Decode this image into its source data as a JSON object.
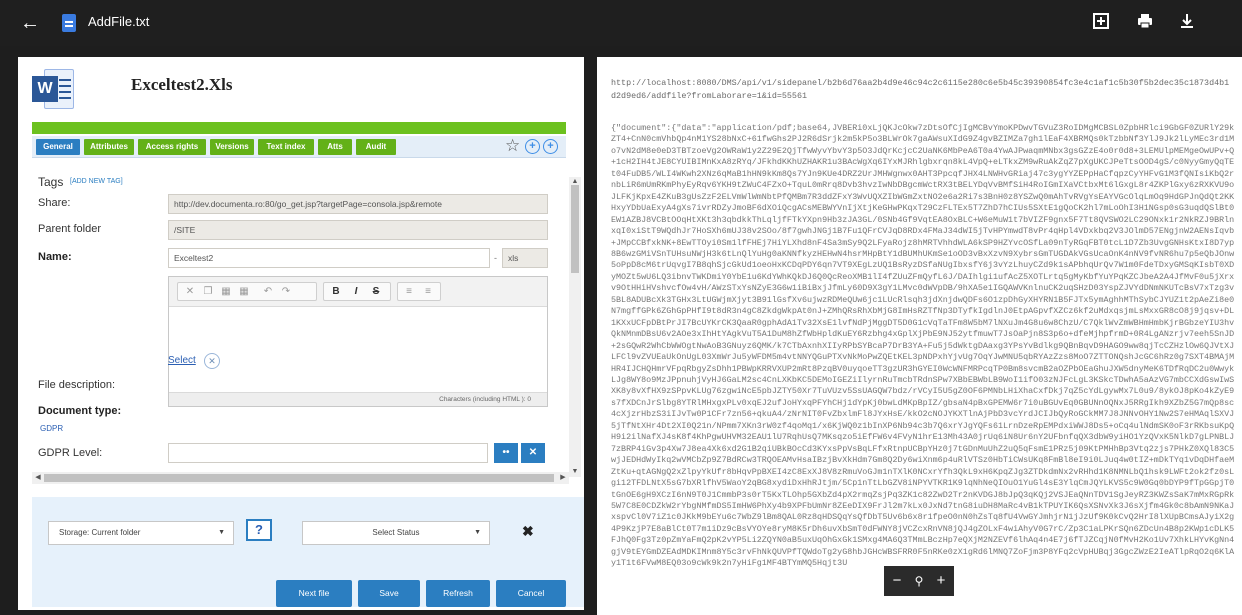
{
  "viewer": {
    "file_name": "AddFile.txt",
    "icons": [
      "back-arrow-icon",
      "text-file-icon",
      "add-box-icon",
      "print-icon",
      "download-icon"
    ]
  },
  "form": {
    "title": "Exceltest2.Xls",
    "tabs": [
      "General",
      "Attributes",
      "Access rights",
      "Versions",
      "Text index",
      "Atts",
      "Audit"
    ],
    "tags_label": "Tags",
    "add_tag": "[ADD NEW TAG]",
    "share_label": "Share:",
    "share_value": "http://dev.documenta.ro:80/go_get.jsp?targetPage=consola.jsp&remote",
    "parent_label": "Parent folder",
    "parent_value": "/SITE",
    "name_label": "Name:",
    "name_value": "Exceltest2",
    "ext_value": "xls",
    "description_label": "File description:",
    "editor_footer": "Characters (including HTML ): 0",
    "doctype_label": "Document type:",
    "doctype_select": "Select",
    "gdpr_link": "GDPR",
    "gdpr_level_label": "GDPR Level:",
    "storage_select": "Storage: Current folder",
    "help_label": "?",
    "status_select": "Select Status",
    "buttons": {
      "next": "Next file",
      "save": "Save",
      "refresh": "Refresh",
      "cancel": "Cancel"
    }
  },
  "preview": {
    "url": "http://localhost:8080/DMS/api/v1/sidepanel/b2b6d76aa2b4d9e46c94c2c6115e280c6e5b45c39390854fc3e4c1af1c5b30f5b2dec35c1873d4b1d2d9ed6/addfile?fromLaborare=1&id=55561",
    "payload": "{\"document\":{\"data\":\"application/pdf;base64,JVBERi0xLjQKJcOkw7zDtsOfCjIgMCBvYmoKPDwvTGVuZ3RoIDMgMCBSL0ZpbHRlci9GbGF0ZURlY29kZT4+CnN0cmVhbQp4nM1YS28bNxC+61fwGhs2PJ2R6dSrjk2m5kP5o3BLWrOk7gaAWsuXIdG9Z4gvBZIMZa7gh1lEaF4XBRMQs0kTzbbNf3YlJ9Jk2lLyMEc3rd1Mo7vN2dM8e0eD3TBTzoeVg2OWRaW1y2Z29E2QjTfwWyvYbvY3p5O3JdQrKcjcC2UaNK6MbPeA6T0a4YwAJPwaqmMNbx3gsGZzE4o0r0d8+3LEMUlpMEMgeOwUPv+Q+1cH2IH4tJE8CYUIBIMnKxA8zRYq/JFkhdKKhUZHAKR1u3BAcWgXq6IYxMJRhlgbxrqn8kL4VpQ+eLTkxZM9wRuAkZqZ7pXgUKCJPeTtsOOD4gS/c0NyyGmyQqTEt04FuDB5/WLI4WKwh2XNz6qMaB1hHN9kKm8Qs7YJn9KUe4DRZ2UrJMHWgnwx0AHT3PpcqfJHX4LNWHvGRiaj47c3ygYYZEPpHaCfqpzCyYHFvG1M3fQNIsiKbQ2rnbLiR6mUmRKmPhyEyRqv6YKH9tZWuC4FZxO+TquL0mRrq8Dvb3hvzIwNbDBgcmWctRX3tBELYDqVvBMfSiH4RoIGmIXaVCtbxMt6lGxgL8r4ZKPlGxy6zRXKVU9oJLFKjKpxE4ZKuB3gUsZzF2ELVmWlWmNbtPfQMBm7R3ddZFxY3WvUQXZIbWGmZxtNO2e6a2Ri7s3BnH0z8YSZwQ0mAhTvRVgYsEAYVGcOlqLmOq9HdGPJnQdQt2KKHxyYDbUaExyA4gXs7ivrRDZyJmoBF6dXOiQcgACsMEBWYVnIjXtjKeGHwPKqxT29CzFLTEx5T7ZhD7hCIUs5SXtE1gQoCK2hl7mLoOhI3H1NGsp0sG3uqdQSlBt0EW1AZBJ8VCBtOOqHtXKt3h3qbdkkThLqljfFTkYXpn9Hb3zJA3GL/0SNb4Gf9VqtEA8OxBLC+W6eMuW1t7bVIZF9gnx5F7Tt8QVSWO2LC29ONxk1r2NkRZJ9BRlnxqI0xiStT9WQdhJr7HoSXh6mUJ38v2SOo/8f7gwhJNGj1B7Fu1QFrCVJqD8RDx4FMaJ34dWI5jTvHPYmwdT8vPr4qHpl4VDxkbq2V3JOlmD57ENgjnW2AENsIqvb+JMpCCBfxkNK+8EwTTOyi0Sm1lfFHEj7HiYLXhd8nF4Sa3mSy9Q2LFyaRojz8hMRTVhhdWLA6kSP9HZYvcOSfLa09nTyRGqFBT0tcL1D7Zb3UvgGNHsKtxI8D7yp8B6wzGMiVSnTUHsuNWjH3k6tLnQlYuHg0aKNNfkyzHEHwN4hsrMHpBtY1dBUMhUKmSe1oOD3vBxXzvN9XybrsGmTUGDAkVGsUcaOnK4nNV9fvNR6hu7p5eQbJOnw5oPpD8cM6trUqvgI7B8qhSjcGkUd1oeoHxKCDqPDY6qn7VT9XEgLzUQ1BsRyzDSfaNUgIbxsfY6j3vYzLhuyCZd9k1sAPbhqUrQv7W1m0FdeTDxyGMSqKIsbT0XDyMOZt5wU6LQ3ibnvTWKDmiY0YbE1u6KdYWhKQkDJ6Q0QcReoXMB1lI4fZUuZFmQyfL6J/DAIhlgi1ufAcZ5XOTLrtq5gMyKbfYuYPqKZCJbeA2A4JfMvF0u5jXrxv9OtHHiHVshvcfOw4vH/AWzSTxYsNZyE3G6w1iBiBxjJfmLy60D9X3gY1LMvc0dWVpDB/9hXA5e1IGQAWVKnlnuCK2uqSHzD03YspZJVYdDNmNKUTcBsV7xTzg3v5BL8ADUBcXk3TGHx3LtUGWjmXjyt3B91lGsfXv6ujwzRDMeQUw6jc1LUcRlsqh3jdXnjdwQDFs6O1zpDhGyXHYRN1B5FJTx5ymAghhMThSybCJYUZ1t2pAeZi8e0N7mgffGPk6ZGhGpPHfI9t8dR3n4gC8ZkdgWkpAt0nJ+ZMhQRsRhXbMjG8ImHsRZTfNp3DTyfkIgdlnJ0EtpAGpvfXZCz6kf2uMdxqsjmLsMxxGR8cO8j9jqsv+DL1KXxUCFpDBtPrJI7BcUYKrCK3QaaR0gphAdA1Tv32XsE1lvfNdPjMggDT5D0G1cVqTaTFm8W5bM7lNXuJm4G8u6w8ChzU/C7QklWvZmWBHmHmbKjrBGbzeYIU3hvQkNMnmDBsU6v2AOe3xIhHtYAgkVuT5A1DuM8hZfWbHpldKuEY6Rzbhg4xGplXjPbE9NJ52ytfmuwT7JsOaPjn8S3p6o+dfeMjhpfrmD+0R4LgANzrjv7eeh5SnJD+2sGQwR2WhCbWWOgtNwAoB3GNuyz6QMK/k7CTbAxnhXIIyRPbSYBcaP7DrB3YA+Fu5j5dWktgDAaxg3YPsYvBdlkg9QBnBqvD9HAGO9ww8qjTcCZHzlOw6QJVtXJLFCl9vZVUEaUkOnUgL03XmWrJu5yWFDM5m4vtNNYQGuPTXvNkMoPwZQEtKEL3pNDPxhYjvUg7OqYJwMNU5qbRYAzZzs8MoO7ZTTONQshJcGC6hRz0g7SXT4BMAjMHR4IJCHQHmrVFpqRbgyZsDhh1PBWpKRRVXUP2mRt8PzqBV0uyqoeTT3gzUR3hGYEI0WcWNFMRPcqTP0Bm8svcmB2aOZPbOEaGhuJXW5dnyMeK6TDfRqDC2u0WwykLJg8WY8o9MzJPpnuhjVyHJ6GaLM2sc4CnLXKbKC5DEMoIGEZiIlyrnRuTmcbTRdnSPw7XBbEBWbLB9WoI1ifO03zNJFcLgL3KSkcTDwhA5aAzVG7mbCCXdGswIwSXK8y8vXfHX9zSPpvKLUg76zgwiNcE5pbJZTY50Xr7TuVUzv5SsUAGQW7bdz/rVCyI5U5gZ0OF6PMNbLHiXhaCxfDkj7qZ5cYdLgywMx7L0u9/8ykOJ8pKo4kZyE9s7fXDCnJrSlbg8YTRlMHxgxPLv0xqEJ2ufJoHYxqPFYhCHj1dYpKj0bwLdMKpBpIZ/gbsaN4pBxGPEMW6r7i0uBGUvEq0GBUNnOQNxJ5RRgIkh9XZbZ5G7mQp8sc4cXjzrHbzS3iIJvTw0P1CFr7zn56+qkuA4/zNrNIT0FvZbxlmFl8JYxHsE/kkO2cNOJYKXTlnAjPbD3vcYrdJCIJbQyRoGCkMM7J8JNNvOHY1Nw2S7eHMAqlSXVJ5jTfNtXHr4Dt2XI0Q21n/NPmm7XKn3rW0zf4qoMq1/x6KjWQ0z1bInXP6Nb94c3b7Q6xrYJgYQFs61LrnDzeRpEMPdxiWWJ8Ds5+oCq4ulNdmSK0oF3rRKbsuKpQH9i2ilNafXJ4sK8f4KhPgwUHVM32EAU1lU7RqhUsQ7MKsqzo5iEfFW6v4FVyN1hrE13Mh43A0jrUq6iN8Ur6nY2UFbnfqQX3dbW9yiHO1YzQVxK5NlkD7gLPNBLJ7zBRP4iGv3p4Xw7J8ea4Xk6xd2G1B2qiUBkBOcCd3KYxsPpVsBqLFfxRtnpUCBpYHz0j7tGDnMuUhZ2uQ5qFsmE1PRz5j09KtPMHhBp3Vtq2zjs7PHkZ0XQl83C5wjJEDHdWyIkq2wVMCbZp9Z7BdRCw3TRQOEAMvHsaIBzjBvXkHdm7Gm8Q2Dy6wiXnm6p4uRlVTSz0HbTiCWsUKq8FmBl8eI9i0LJuq4w0tIZ+mDkTYq1vDqDHfaeMZtKu+qtAGNgQ2xZlpyYkUfr8bHqvPpBXEI4zC8ExXJ8V8zRmuVoGJm1nTXlK0NCxrYfh3QkL9xH6KpqZJg3ZTDkdmNx2vRHhd1K8NMNLbQ1hsk9LWFt2ok2fz0sLgi12TFDLNtX5sG7bXRlfhV5WaoY2qBG8xydiDxHhRJtjm/5Cp1nTtLbGZV8iNPYVTKR1K9lqNhNeQIOuO1YuGl4sE3YlqCmJQYLKVS5c9W0Gq0bDYP9fTpGGpjT0tGnOE6gH9XCzI6nN9T0J1CmmbP3s0rT5KxTLOhp5GXbZd4pX2rmqZsjPq3ZK1c82ZwD2Tr2nKVDGJ8bJpQ3qKQj2VSJEaQNnTDV1SgJeyRZ3KWZsSaK7mMxRGpRk5W7C8E0CDZkW2rYbgNMfmDS5ImHW6PhXy4b9XPFbUmNr8ZEeDIX9FrJl2m7kLx0JxNd7tnG8iuDH8MaRc4vB1kTPUYIK6QsXSNvXk3J6sXjfm4Gk0c8bAmN9NKaJxspvCl0V7iZ1c0JKkM9bEYu6c7WbZ9lBm8QAL0Rz8qHDSQqYsQfDbT5Uv6b6x8r1fpeO0nN0hZsTq8fU4VwGYJmhjrN1jJzUf9K0kCvQ2HrI8lXUpBCmsAJyiX2g4P9KzjP7E8aBlCt0T7m1iDz9cBsVYOYe8ryM8K5rDh6uvXbSmT0dFWNY8jVCZcxRnVN8jQJ4gZOLxF4wiAhyV0G7rC/Zp3C1aLPKrSQn6ZDcUn4B8p2KWp1cDLK5FJhQ0Fg3Tz0pZmYaFmQ2pK2vYP5Li2ZQYN0aB5uxUqOhGxGk1SMxg4MA6Q3TMmLBczHp7eQXjM2NZEVf6lhAq4n4E7j6fTJZCqjN0fMvH2Ko1Uv7XhkLHYvKgNn4gjV9tEYGmDZEAdMDKIMnm8Y5c3rvFhNkQUVPfTQWdoTg2yG8hbJGHcWBSFRR0F5nRKe0zX1gRd6lMNQ7ZoFjm3P8YFq2cVpHUBqj3GgcZWzE2IeATlpRqO2q6KlAy1T1t6FVwM8EQ03o9cWk9k2n7yHiFg1MF4BTYmMQ5Hqjt3U",
    "zoom_icons": [
      "zoom-out-icon",
      "zoom-icon",
      "zoom-in-icon"
    ]
  }
}
